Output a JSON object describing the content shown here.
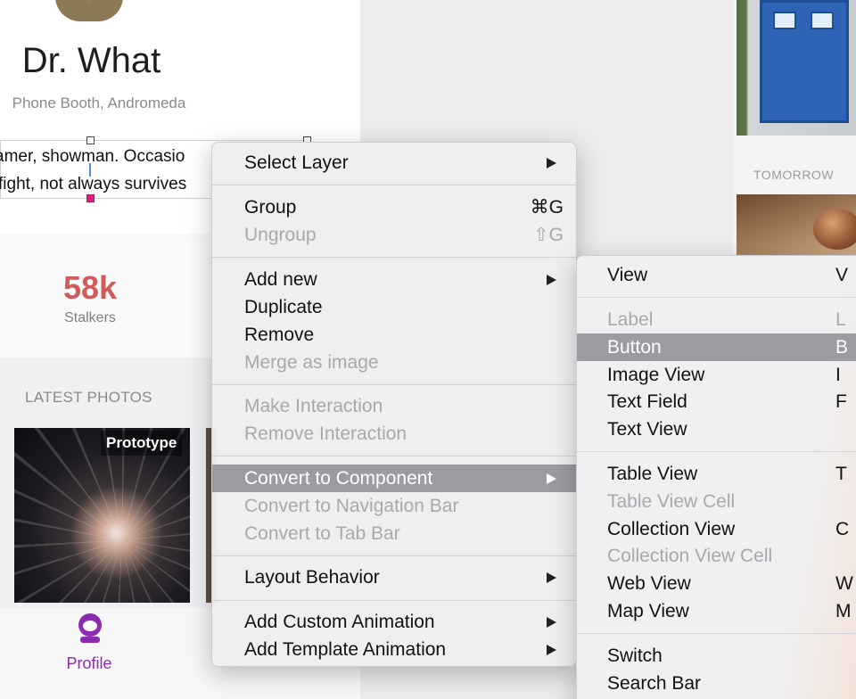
{
  "profile": {
    "name": "Dr. What",
    "location": "Phone Booth, Andromeda",
    "bio_line_1": "amer, showman. Occasio",
    "bio_line_2": "fight, not always survives",
    "stat_value": "58k",
    "stat_label": "Stalkers",
    "photos_heading": "LATEST PHOTOS",
    "photo_badge": "Prototype",
    "tab_label": "Profile",
    "tab_icon": "profile-astronaut-icon",
    "accent_color": "#8c2bb0",
    "stat_color": "#d25a5a"
  },
  "side_screen": {
    "section_label": "TOMORROW"
  },
  "context_menu": {
    "select_layer": "Select Layer",
    "group": "Group",
    "group_shortcut": "⌘G",
    "ungroup": "Ungroup",
    "ungroup_shortcut": "⇧G",
    "add_new": "Add new",
    "duplicate": "Duplicate",
    "remove": "Remove",
    "merge_as_image": "Merge as image",
    "make_interaction": "Make Interaction",
    "remove_interaction": "Remove Interaction",
    "convert_to_component": "Convert to Component",
    "convert_to_navigation_bar": "Convert to Navigation Bar",
    "convert_to_tab_bar": "Convert to Tab Bar",
    "layout_behavior": "Layout Behavior",
    "add_custom_animation": "Add Custom Animation",
    "add_template_animation": "Add Template Animation"
  },
  "sub_menu": {
    "view": "View",
    "view_shortcut": "V",
    "label": "Label",
    "label_shortcut": "L",
    "button": "Button",
    "button_shortcut": "B",
    "image_view": "Image View",
    "image_view_shortcut": "I",
    "text_field": "Text Field",
    "text_field_shortcut": "F",
    "text_view": "Text View",
    "table_view": "Table View",
    "table_view_shortcut": "T",
    "table_view_cell": "Table View Cell",
    "collection_view": "Collection View",
    "collection_view_shortcut": "C",
    "collection_view_cell": "Collection View Cell",
    "web_view": "Web View",
    "web_view_shortcut": "W",
    "map_view": "Map View",
    "map_view_shortcut": "M",
    "switch": "Switch",
    "search_bar": "Search Bar"
  },
  "colors": {
    "highlight": "#9b9ca2",
    "disabled_text": "#a9a9ad"
  }
}
